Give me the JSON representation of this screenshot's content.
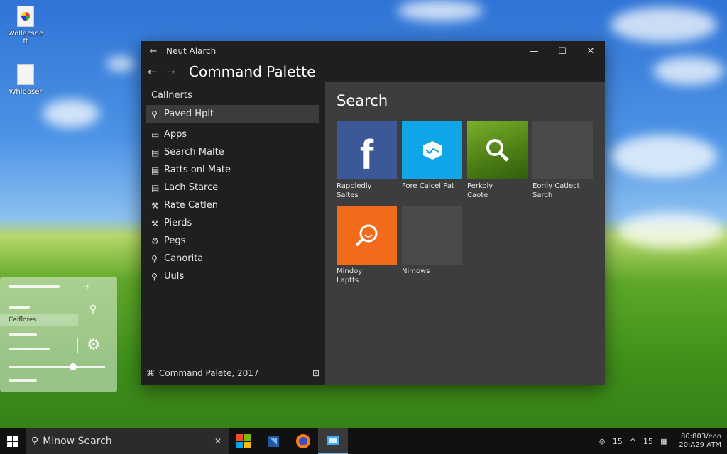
{
  "desktop": {
    "icons": [
      {
        "label": "Wollacsne\nft"
      },
      {
        "label": "Whlboser"
      }
    ]
  },
  "window": {
    "title": "Neut Alarch",
    "header_title": "Command Palette",
    "sidebar": {
      "section": "Callnerts",
      "items": [
        {
          "label": "Paved Hplt",
          "icon": "search-icon"
        },
        {
          "label": "Apps",
          "icon": "app-icon"
        },
        {
          "label": "Search Malte",
          "icon": "list-icon"
        },
        {
          "label": "Ratts onl Mate",
          "icon": "list-icon"
        },
        {
          "label": "Lach Starce",
          "icon": "list-icon"
        },
        {
          "label": "Rate Catlen",
          "icon": "wrench-icon"
        },
        {
          "label": "Pierds",
          "icon": "wrench-icon"
        },
        {
          "label": "Pegs",
          "icon": "gear-icon"
        },
        {
          "label": "Canorita",
          "icon": "search-icon"
        },
        {
          "label": "Uuls",
          "icon": "search-icon"
        }
      ],
      "footer": "Command Palete, 2017"
    },
    "panel": {
      "title": "Search",
      "tiles": [
        {
          "label": "Rappledly\nSaltes",
          "color": "#3b5998",
          "icon": "facebook-icon"
        },
        {
          "label": "Fore Calcel Pat",
          "color": "#0ea5e9",
          "icon": "box-icon"
        },
        {
          "label": "Perkoly\nCaote",
          "color": "#5a8f1c",
          "icon": "magnifier-icon"
        },
        {
          "label": "Eorily Catlect\nSarch",
          "color": "#4a4a4a",
          "icon": ""
        },
        {
          "label": "Mindoy\nLaptts",
          "color": "#f26b1d",
          "icon": "search-icon"
        },
        {
          "label": "Nimows",
          "color": "#4a4a4a",
          "icon": ""
        }
      ]
    }
  },
  "widget": {
    "label": "Celflores"
  },
  "taskbar": {
    "search_text": "Minow Search",
    "tray_num1": "15",
    "tray_num2": "15",
    "clock_line1": "80:803/eoo",
    "clock_line2": "20:A29 ATM"
  }
}
